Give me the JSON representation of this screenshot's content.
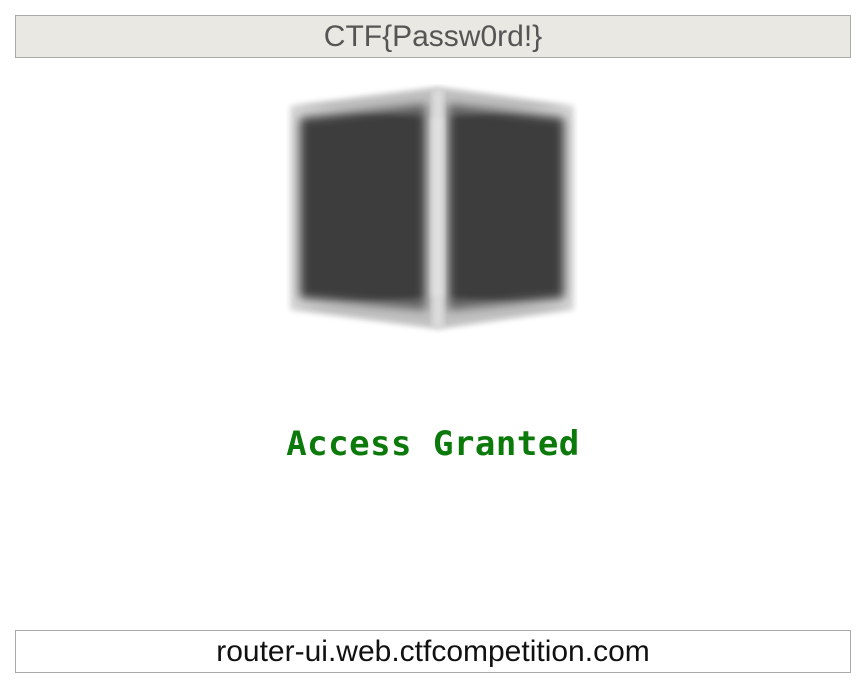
{
  "header": {
    "flag_text": "CTF{Passw0rd!}"
  },
  "main": {
    "status_text": "Access Granted",
    "status_color": "#0b7a0b",
    "cube_color": "#3e3e3e"
  },
  "footer": {
    "hostname": "router-ui.web.ctfcompetition.com"
  }
}
